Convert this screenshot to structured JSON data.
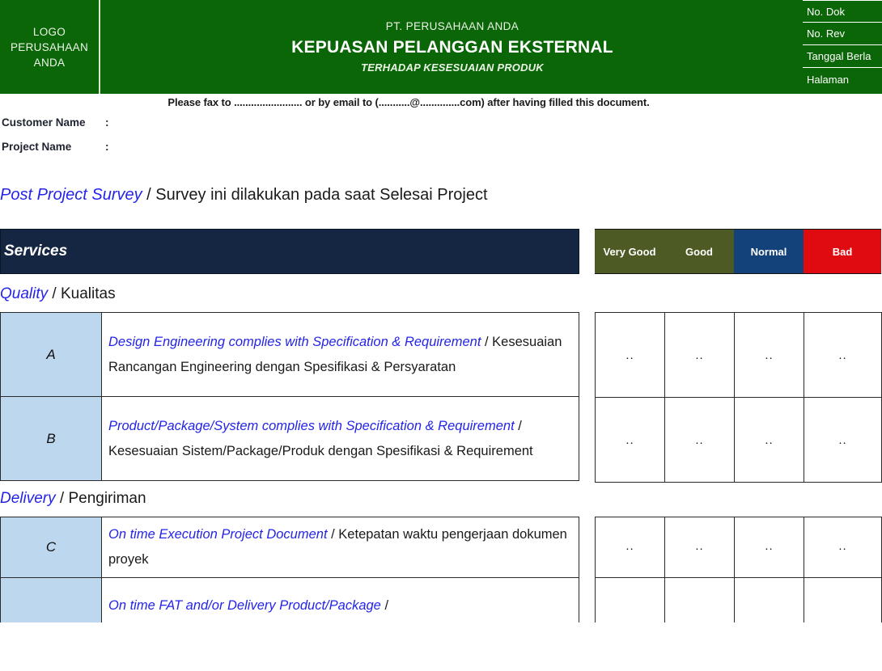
{
  "header": {
    "logo_text": "LOGO\nPERUSAHAAN\nANDA",
    "logo_line1": "LOGO",
    "logo_line2": "PERUSAHAAN",
    "logo_line3": "ANDA",
    "company": "PT. PERUSAHAAN ANDA",
    "title": "KEPUASAN PELANGGAN EKSTERNAL",
    "subtitle": "TERHADAP KESESUAIAN PRODUK",
    "green": "#0b6608",
    "doc_meta": [
      {
        "label": "No. Dok"
      },
      {
        "label": "No. Rev"
      },
      {
        "label": "Tanggal Berla"
      },
      {
        "label": "Halaman"
      }
    ]
  },
  "instruction": "Please fax to ........................ or by email to (...........@..............com) after having filled  this document.",
  "fields": [
    {
      "label": "Customer Name",
      "colon": ":",
      "value": ""
    },
    {
      "label": "Project Name",
      "colon": ":",
      "value": ""
    }
  ],
  "survey_line": {
    "en": "Post Project Survey",
    "id": " / Survey ini dilakukan pada saat Selesai Project"
  },
  "services_bar": {
    "label": "Services",
    "bg": "#142642"
  },
  "rating_columns": [
    {
      "label": "Very Good",
      "color": "#4d5a24"
    },
    {
      "label": "Good",
      "color": "#4d5a24"
    },
    {
      "label": "Normal",
      "color": "#13427a"
    },
    {
      "label": "Bad",
      "color": "#e00b11"
    }
  ],
  "rating_mark": "..",
  "sections": [
    {
      "key": "quality",
      "title_en": "Quality",
      "title_id": " / Kualitas",
      "rows": [
        {
          "letter": "A",
          "en": "Design Engineering complies with Specification & Requirement",
          "id": " / Kesesuaian Rancangan Engineering dengan Spesifikasi & Persyaratan",
          "marks": [
            "..",
            "..",
            "..",
            ".."
          ]
        },
        {
          "letter": "B",
          "en": "Product/Package/System complies with Specification & Requirement",
          "id": " / Kesesuaian Sistem/Package/Produk dengan Spesifikasi & Requirement",
          "marks": [
            "..",
            "..",
            "..",
            ".."
          ]
        }
      ]
    },
    {
      "key": "delivery",
      "title_en": "Delivery",
      "title_id": " / Pengiriman",
      "rows": [
        {
          "letter": "C",
          "en": "On time Execution Project Document",
          "id": " / Ketepatan waktu pengerjaan dokumen proyek",
          "marks": [
            "..",
            "..",
            "..",
            ".."
          ]
        },
        {
          "letter": "",
          "en": "On time FAT and/or Delivery Product/Package",
          "id": " /",
          "marks": [
            "",
            "",
            "",
            ""
          ]
        }
      ]
    }
  ]
}
